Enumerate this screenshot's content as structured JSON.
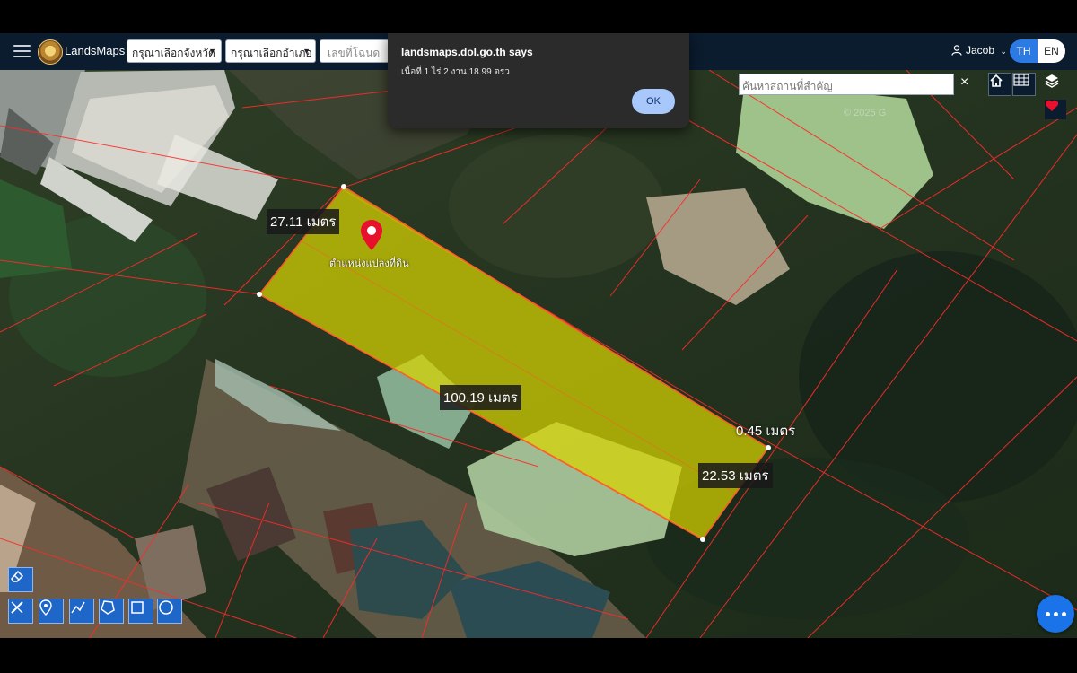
{
  "header": {
    "brand": "LandsMaps",
    "province_select": "กรุณาเลือกจังหวัด",
    "district_select": "กรุณาเลือกอำเภอ",
    "deed_placeholder": "เลขที่โฉนด",
    "user_name": "Jacob",
    "lang_th": "TH",
    "lang_en": "EN"
  },
  "map": {
    "search_placeholder": "ค้นหาสถานที่สำคัญ",
    "clear_symbol": "×",
    "watermark": "© 2025 G",
    "pin_caption": "ตำแหน่งแปลงที่ดิน",
    "measurements": {
      "top_edge": "27.11 เมตร",
      "long_edge": "100.19 เมตร",
      "short_segment": "0.45 เมตร",
      "bottom_edge": "22.53 เมตร"
    },
    "parcel_fill_color": "#d8d400",
    "parcel_line_color": "#ff3b3b",
    "pin_color": "#e8112d"
  },
  "dialog": {
    "title": "landsmaps.dol.go.th says",
    "message": "เนื้อที่ 1 ไร่ 2 งาน 18.99 ตรว",
    "ok_label": "OK"
  },
  "tools": [
    "eraser-icon",
    "ruler-icon",
    "marker-icon",
    "polyline-icon",
    "polygon-icon",
    "rectangle-icon",
    "circle-icon"
  ]
}
